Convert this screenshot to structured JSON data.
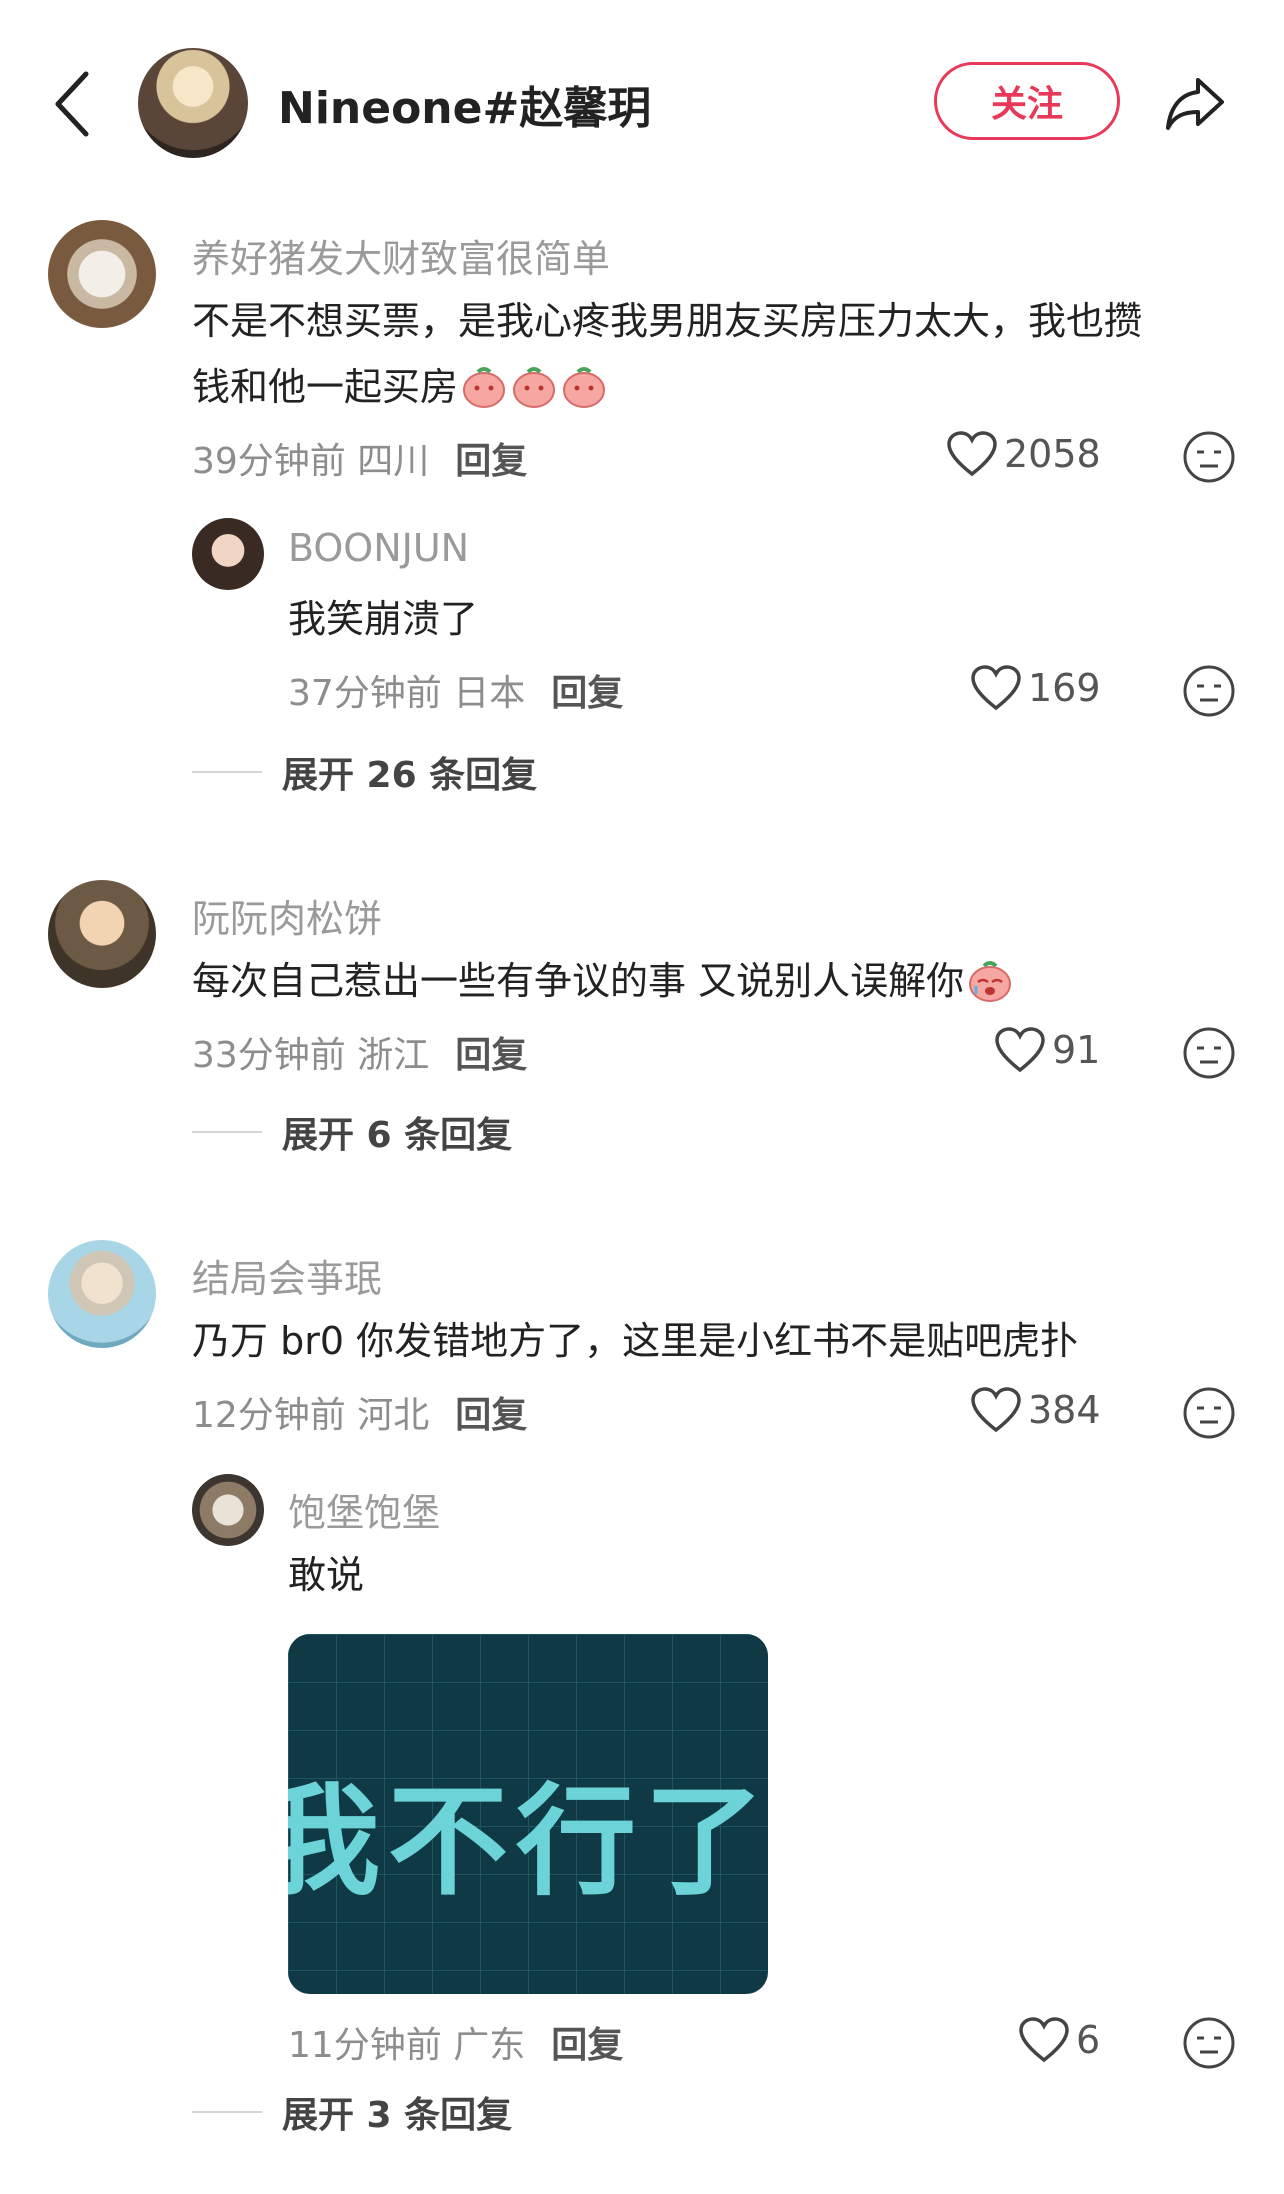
{
  "header": {
    "title": "Nineone#赵馨玥",
    "follow_label": "关注"
  },
  "comments": [
    {
      "username": "养好猪发大财致富很简单",
      "text_line1": "不是不想买票，是我心疼我男朋友买房压力太大，我也攒",
      "text_line2": "钱和他一起买房",
      "meta": "39分钟前 四川",
      "reply_label": "回复",
      "likes": "2058",
      "replies": [
        {
          "username": "BOONJUN",
          "text": "我笑崩溃了",
          "meta": "37分钟前 日本",
          "reply_label": "回复",
          "likes": "169"
        }
      ],
      "expand_label": "展开 26 条回复"
    },
    {
      "username": "阮阮肉松饼",
      "text": "每次自己惹出一些有争议的事 又说别人误解你",
      "meta": "33分钟前 浙江",
      "reply_label": "回复",
      "likes": "91",
      "expand_label": "展开 6 条回复"
    },
    {
      "username": "结局会亊珉",
      "text": "乃万 br0 你发错地方了，这里是小红书不是贴吧虎扑",
      "meta": "12分钟前 河北",
      "reply_label": "回复",
      "likes": "384",
      "replies": [
        {
          "username": "饱堡饱堡",
          "text": "敢说",
          "image_text": "我不行了。",
          "meta": "11分钟前 广东",
          "reply_label": "回复",
          "likes": "6"
        }
      ],
      "expand_label": "展开 3 条回复"
    }
  ],
  "colors": {
    "accent": "#e8395a",
    "username": "#9a9a9a",
    "meta": "#8d8d8d"
  }
}
